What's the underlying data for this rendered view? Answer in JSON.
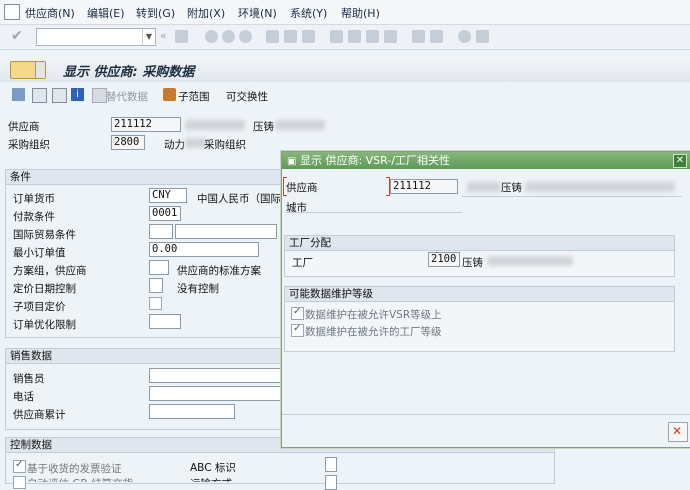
{
  "menu": [
    "供应商(N)",
    "编辑(E)",
    "转到(G)",
    "附加(X)",
    "环境(N)",
    "系统(Y)",
    "帮助(H)"
  ],
  "title": "显示 供应商: 采购数据",
  "app_toolbar": {
    "alt_data": "替代数据",
    "subrange": "子范围",
    "interchangeable": "可交换性"
  },
  "header": {
    "vendor_label": "供应商",
    "vendor_value": "211112",
    "vendor_name_tail": "压铸",
    "porg_label": "采购组织",
    "porg_value": "2800",
    "porg_desc_start": "动力",
    "porg_desc_end": "采购组织"
  },
  "conditions": {
    "title": "条件",
    "order_currency_label": "订单货币",
    "order_currency_value": "CNY",
    "currency_desc": "中国人民币（国际）",
    "payment_terms_label": "付款条件",
    "payment_terms_value": "0001",
    "incoterms_label": "国际贸易条件",
    "min_order_label": "最小订单值",
    "min_order_value": "0.00",
    "schema_group_label": "方案组，供应商",
    "schema_group_desc": "供应商的标准方案",
    "pricing_date_label": "定价日期控制",
    "pricing_date_desc": "没有控制",
    "item_pricing_label": "子项目定价",
    "order_opt_label": "订单优化限制"
  },
  "sales": {
    "title": "销售数据",
    "salesperson_label": "销售员",
    "phone_label": "电话",
    "acct_label": "供应商累计"
  },
  "control": {
    "title": "控制数据",
    "gr_invoice_label": "基于收货的发票验证",
    "abc_label": "ABC 标识",
    "row2_left": "自动评估 GR 结算交货",
    "row2_right": "运输方式"
  },
  "dialog": {
    "title": "显示 供应商: VSR-/工厂相关性",
    "vendor_label": "供应商",
    "vendor_value": "211112",
    "vendor_name_tail": "压铸",
    "city_label": "城市",
    "plant_group_title": "工厂分配",
    "plant_label": "工厂",
    "plant_value": "2100",
    "plant_name": "压铸",
    "levels_title": "可能数据维护等级",
    "level_vsr": "数据维护在被允许VSR等级上",
    "level_plant": "数据维护在被允许的工厂等级"
  }
}
